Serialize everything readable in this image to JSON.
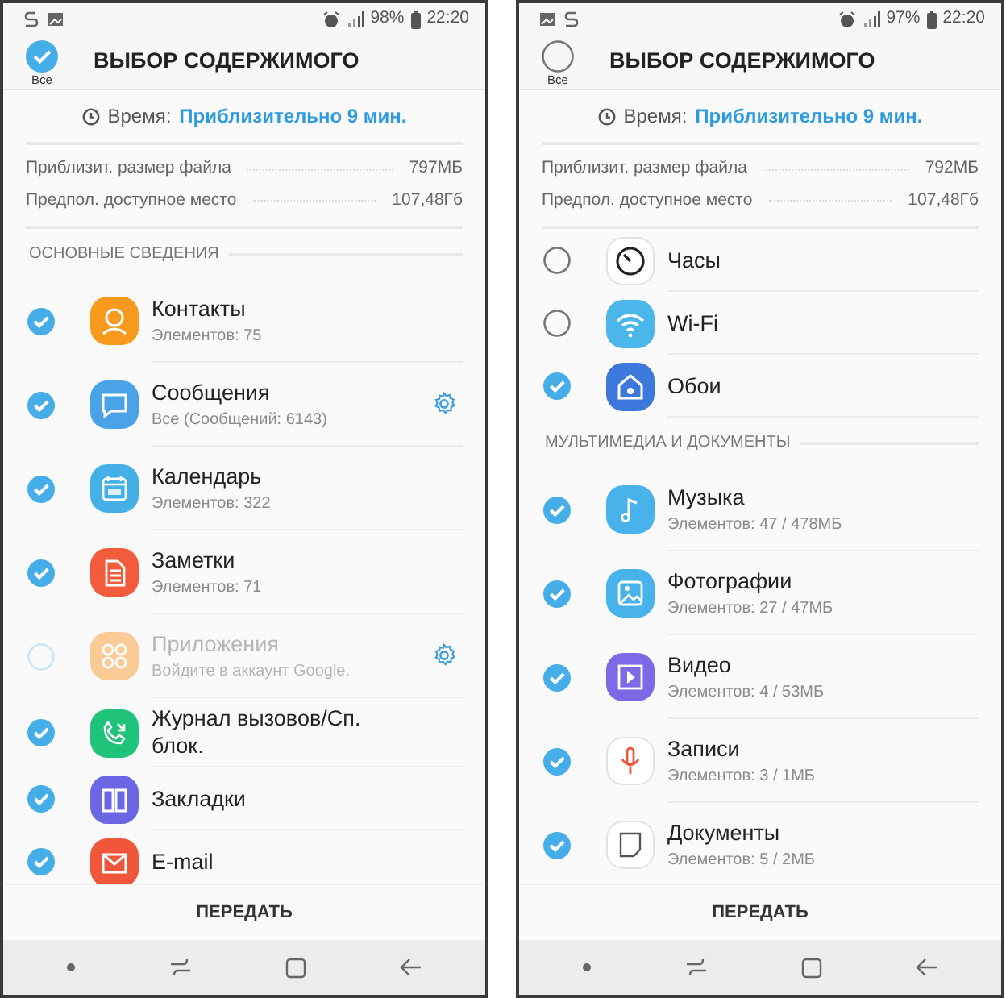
{
  "phones": [
    {
      "status_bar": {
        "battery": "98%",
        "time": "22:20"
      },
      "header": {
        "select_all": {
          "label": "Все",
          "checked": true
        },
        "title": "ВЫБОР СОДЕРЖИМОГО"
      },
      "time_row": {
        "label": "Время:",
        "value": "Приблизительно 9 мин."
      },
      "info": [
        {
          "label": "Приблизит. размер файла",
          "value": "797МБ"
        },
        {
          "label": "Предпол. доступное место",
          "value": "107,48Гб"
        }
      ],
      "list": [
        {
          "kind": "section",
          "title": "ОСНОВНЫЕ СВЕДЕНИЯ"
        },
        {
          "kind": "item",
          "color": "#f79a1e",
          "title": "Контакты",
          "subtitle": "Элементов: 75",
          "checked": true,
          "disabled": false,
          "settings": false
        },
        {
          "kind": "item",
          "color": "#4aa3e6",
          "title": "Сообщения",
          "subtitle": "Все (Сообщений: 6143)",
          "checked": true,
          "disabled": false,
          "settings": true
        },
        {
          "kind": "item",
          "color": "#45b0e8",
          "title": "Календарь",
          "subtitle": "Элементов: 322",
          "checked": true,
          "disabled": false,
          "settings": false
        },
        {
          "kind": "item",
          "color": "#f25b3b",
          "title": "Заметки",
          "subtitle": "Элементов: 71",
          "checked": true,
          "disabled": false,
          "settings": false
        },
        {
          "kind": "item",
          "color": "#fbcb95",
          "title": "Приложения",
          "subtitle": "Войдите в аккаунт Google.",
          "checked": false,
          "disabled": true,
          "settings": true
        },
        {
          "kind": "item",
          "color": "#1fc47a",
          "title": "Журнал вызовов/Сп. блок.",
          "checked": true,
          "disabled": false,
          "settings": false
        },
        {
          "kind": "item",
          "color": "#6a66e4",
          "title": "Закладки",
          "checked": true,
          "disabled": false,
          "settings": false
        },
        {
          "kind": "item",
          "color": "#f0563a",
          "title": "E-mail",
          "checked": true,
          "disabled": false,
          "settings": false
        }
      ],
      "action": "ПЕРЕДАТЬ"
    },
    {
      "status_bar": {
        "battery": "97%",
        "time": "22:20"
      },
      "header": {
        "select_all": {
          "label": "Все",
          "checked": false
        },
        "title": "ВЫБОР СОДЕРЖИМОГО"
      },
      "time_row": {
        "label": "Время:",
        "value": "Приблизительно 9 мин."
      },
      "info": [
        {
          "label": "Приблизит. размер файла",
          "value": "792МБ"
        },
        {
          "label": "Предпол. доступное место",
          "value": "107,48Гб"
        }
      ],
      "list": [
        {
          "kind": "item",
          "color": "#ffffff",
          "title": "Часы",
          "checked": false,
          "disabled": false,
          "settings": false
        },
        {
          "kind": "item",
          "color": "#4ab6ea",
          "title": "Wi-Fi",
          "checked": false,
          "disabled": false,
          "settings": false
        },
        {
          "kind": "item",
          "color": "#3d79dc",
          "title": "Обои",
          "checked": true,
          "disabled": false,
          "settings": false
        },
        {
          "kind": "section",
          "title": "МУЛЬТИМЕДИА И ДОКУМЕНТЫ"
        },
        {
          "kind": "item",
          "color": "#47b3ea",
          "title": "Музыка",
          "subtitle": "Элементов: 47 / 478МБ",
          "checked": true,
          "disabled": false,
          "settings": false
        },
        {
          "kind": "item",
          "color": "#47b3ea",
          "title": "Фотографии",
          "subtitle": "Элементов: 27 / 47МБ",
          "checked": true,
          "disabled": false,
          "settings": false
        },
        {
          "kind": "item",
          "color": "#7c69e6",
          "title": "Видео",
          "subtitle": "Элементов: 4 / 53МБ",
          "checked": true,
          "disabled": false,
          "settings": false
        },
        {
          "kind": "item",
          "color": "#ffffff",
          "title": "Записи",
          "subtitle": "Элементов: 3 / 1МБ",
          "checked": true,
          "disabled": false,
          "settings": false
        },
        {
          "kind": "item",
          "color": "#ffffff",
          "title": "Документы",
          "subtitle": "Элементов: 5 / 2МБ",
          "checked": true,
          "disabled": false,
          "settings": false
        }
      ],
      "action": "ПЕРЕДАТЬ"
    }
  ]
}
